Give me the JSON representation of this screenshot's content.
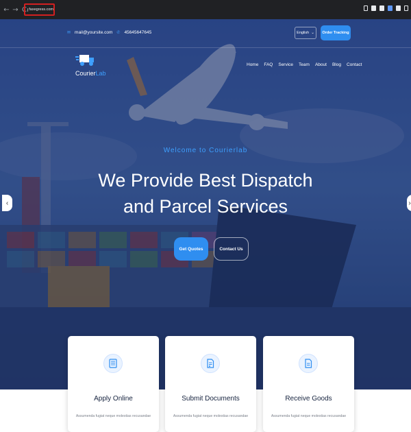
{
  "browser": {
    "nav": [
      "←",
      "→",
      "C"
    ],
    "url": "faxegress.com"
  },
  "topbar": {
    "email": "mail@yoursite.com",
    "phone": "45645647645",
    "language": "English",
    "order_button": "Order Tracking"
  },
  "logo": {
    "text_part1": "Courier",
    "text_part2": "Lab"
  },
  "nav": {
    "items": [
      "Home",
      "FAQ",
      "Service",
      "Team",
      "About",
      "Blog",
      "Contact"
    ]
  },
  "hero": {
    "subtitle": "Welcome to Courierlab",
    "headline_line1": "We Provide Best Dispatch",
    "headline_line2": "and Parcel Services",
    "primary_button": "Get Quotes",
    "secondary_button": "Contact Us",
    "prev_arrow": "‹",
    "next_arrow": "›"
  },
  "cards": [
    {
      "title": "Apply Online",
      "icon": "form-icon",
      "text": "Assumenda fugiat neque molestias recusandae"
    },
    {
      "title": "Submit Documents",
      "icon": "document-icon",
      "text": "Assumenda fugiat neque molestias recusandae"
    },
    {
      "title": "Receive Goods",
      "icon": "file-icon",
      "text": "Assumenda fugiat neque molestias recusandae"
    }
  ],
  "colors": {
    "accent": "#2f8ef0",
    "hero_overlay": "#1f3a78",
    "card_title": "#14213d"
  }
}
